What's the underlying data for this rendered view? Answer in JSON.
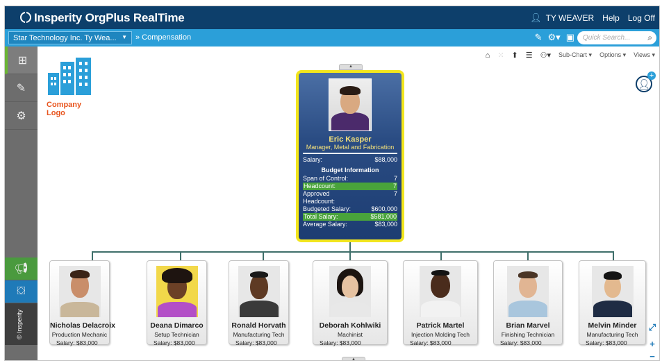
{
  "header": {
    "brand": "Insperity OrgPlus RealTime",
    "user_name": "TY WEAVER",
    "help_label": "Help",
    "logoff_label": "Log Off"
  },
  "subheader": {
    "company_select": "Star Technology Inc. Ty Wea...",
    "breadcrumb": "» Compensation",
    "search_placeholder": "Quick Search..."
  },
  "sidebar": {
    "vertical_brand": "© Insperity"
  },
  "toolbar": {
    "subchart_label": "Sub-Chart ▾",
    "options_label": "Options ▾",
    "views_label": "Views ▾"
  },
  "logo": {
    "text": "Company Logo"
  },
  "manager": {
    "name": "Eric Kasper",
    "title": "Manager, Metal and Fabrication",
    "salary_label": "Salary:",
    "salary": "$88,000",
    "budget_heading": "Budget Information",
    "span_label": "Span of Control:",
    "span": "7",
    "headcount_label": "Headcount:",
    "headcount": "7",
    "approved_label": "Approved Headcount:",
    "approved": "7",
    "budgeted_label": "Budgeted Salary:",
    "budgeted": "$600,000",
    "total_label": "Total Salary:",
    "total": "$581,000",
    "average_label": "Average Salary:",
    "average": "$83,000"
  },
  "employees": [
    {
      "name": "Nicholas Delacroix",
      "title": "Production Mechanic",
      "salary": "Salary: $83,000"
    },
    {
      "name": "Deana Dimarco",
      "title": "Setup Technician",
      "salary": "Salary: $83,000"
    },
    {
      "name": "Ronald Horvath",
      "title": "Manufacturing Tech",
      "salary": "Salary: $83,000"
    },
    {
      "name": "Deborah Kohlwiki",
      "title": "Machinist",
      "salary": "Salary: $83,000"
    },
    {
      "name": "Patrick Martel",
      "title": "Injection Molding Tech",
      "salary": "Salary: $83,000"
    },
    {
      "name": "Brian Marvel",
      "title": "Finishing Technician",
      "salary": "Salary: $83,000"
    },
    {
      "name": "Melvin Minder",
      "title": "Manufacturing Tech",
      "salary": "Salary: $83,000"
    }
  ],
  "colors": {
    "header_bg": "#0d3f6b",
    "subheader_bg": "#2b9fd9",
    "highlight_green": "#49a33b",
    "selected_border": "#f3e61e",
    "logo_blue": "#2b9fd9",
    "logo_orange": "#e8541d"
  }
}
